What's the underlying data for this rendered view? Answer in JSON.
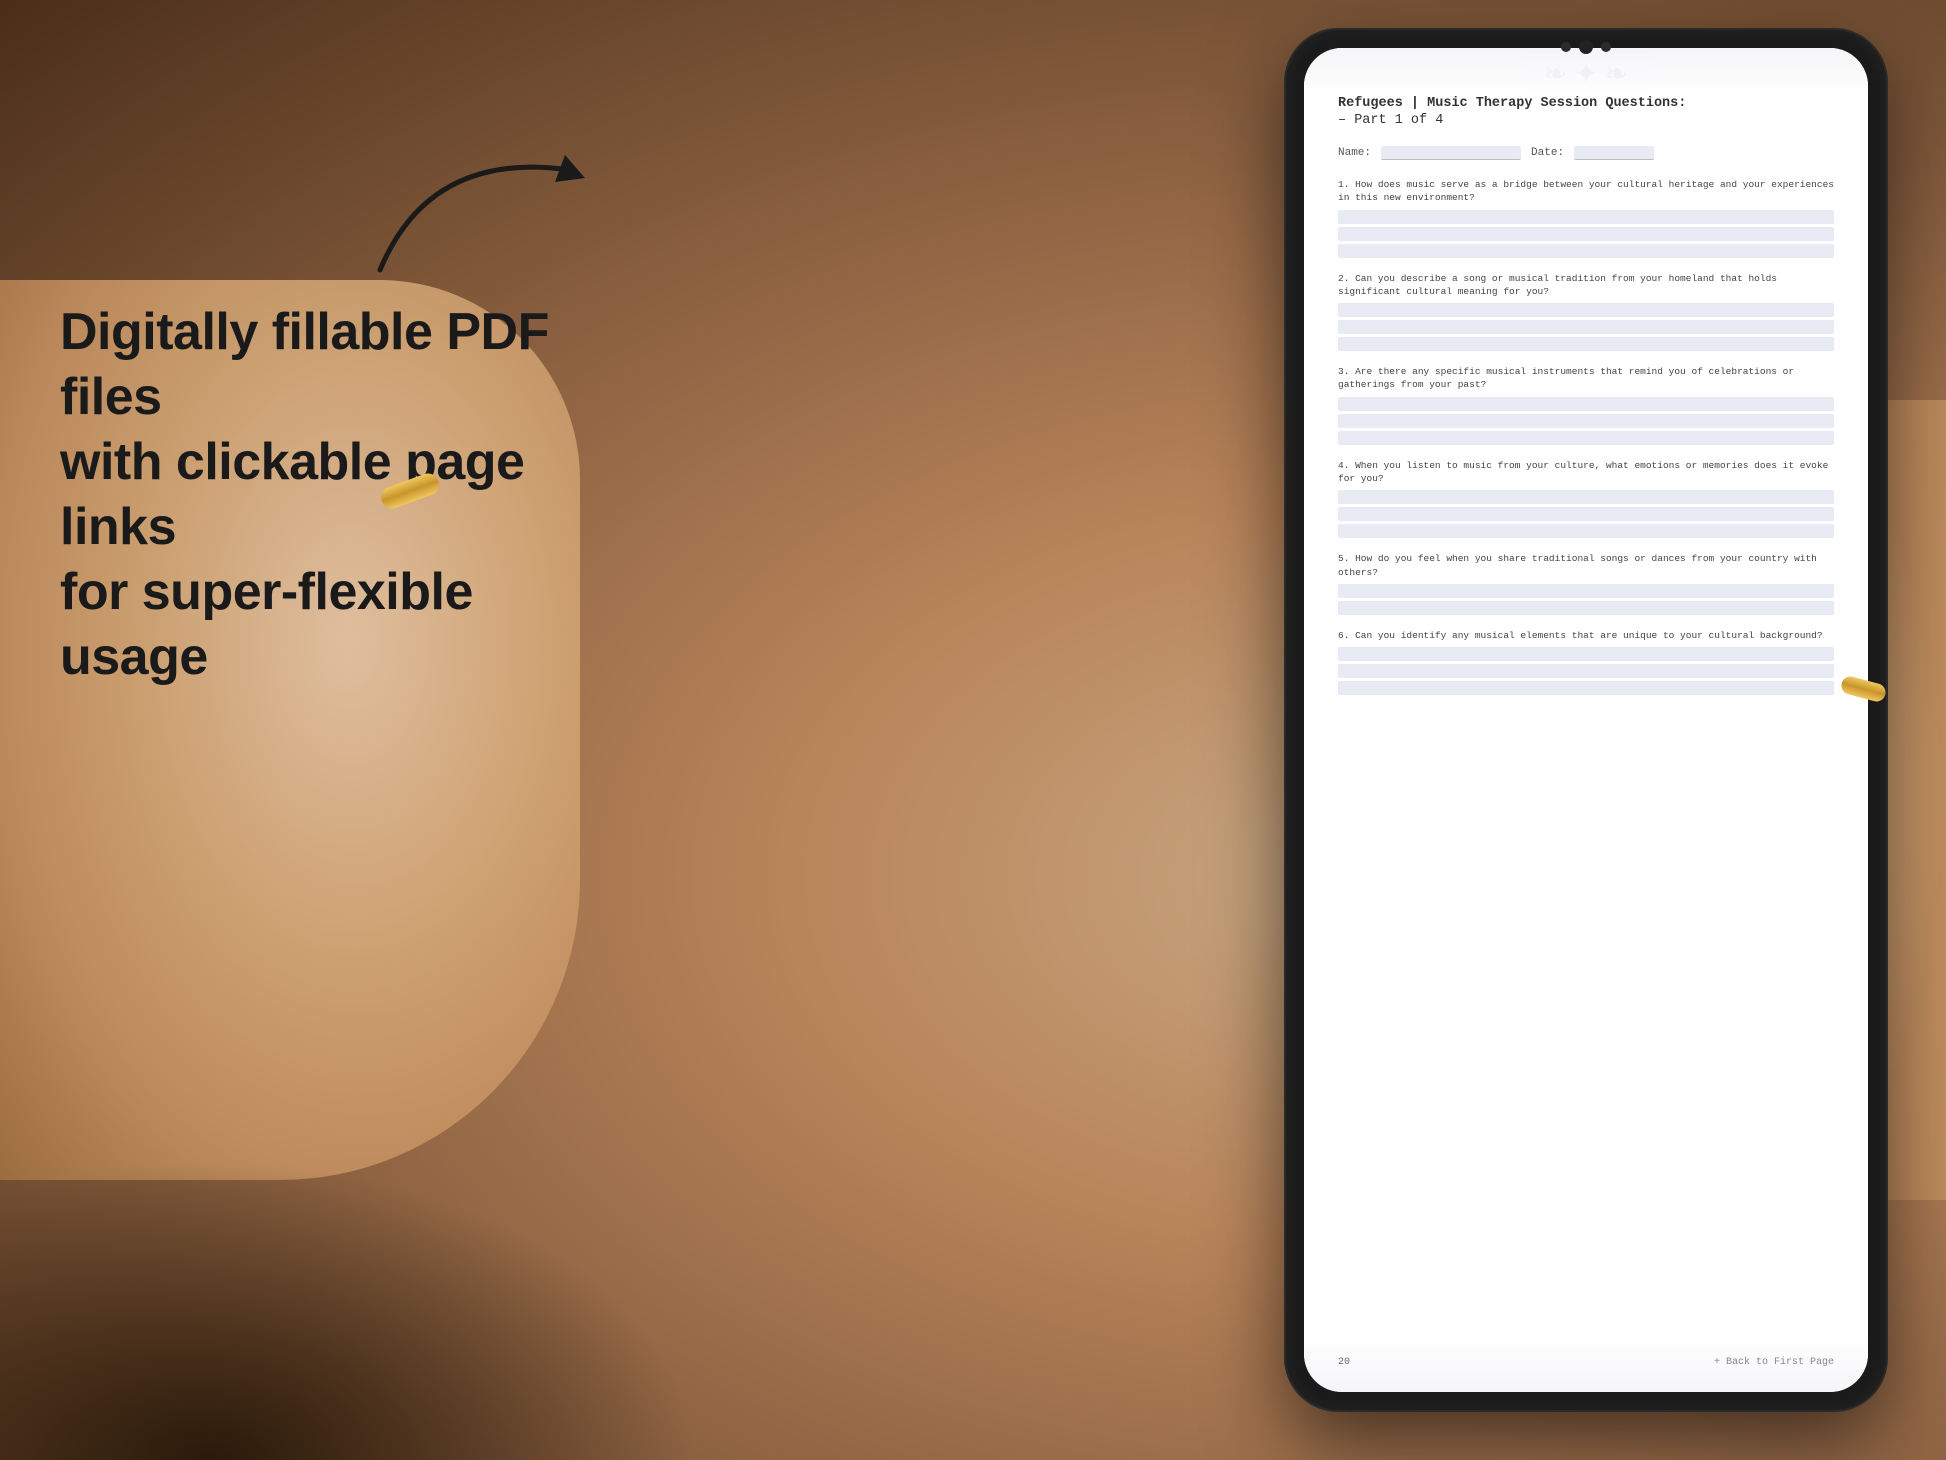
{
  "background": {
    "color_left": "#b8956a",
    "color_right": "#8a6040"
  },
  "left_panel": {
    "main_text_line1": "Digitally fillable PDF files",
    "main_text_line2": "with clickable page links",
    "main_text_line3": "for super-flexible usage"
  },
  "arrow": {
    "label": "curved arrow pointing right"
  },
  "tablet": {
    "document": {
      "title": "Refugees | Music Therapy Session Questions:",
      "subtitle": "– Part 1 of 4",
      "name_label": "Name:",
      "date_label": "Date:",
      "questions": [
        {
          "number": "1.",
          "text": "How does music serve as a bridge between your cultural heritage and your experiences in this new environment?",
          "answer_lines": 3
        },
        {
          "number": "2.",
          "text": "Can you describe a song or musical tradition from your homeland that holds significant cultural meaning for you?",
          "answer_lines": 3
        },
        {
          "number": "3.",
          "text": "Are there any specific musical instruments that remind you of celebrations or gatherings from your past?",
          "answer_lines": 3
        },
        {
          "number": "4.",
          "text": "When you listen to music from your culture, what emotions or memories does it evoke for you?",
          "answer_lines": 3
        },
        {
          "number": "5.",
          "text": "How do you feel when you share traditional songs or dances from your country with others?",
          "answer_lines": 2
        },
        {
          "number": "6.",
          "text": "Can you identify any musical elements that are unique to your cultural background?",
          "answer_lines": 3
        }
      ],
      "page_number": "20",
      "back_link": "+ Back to First Page"
    }
  }
}
